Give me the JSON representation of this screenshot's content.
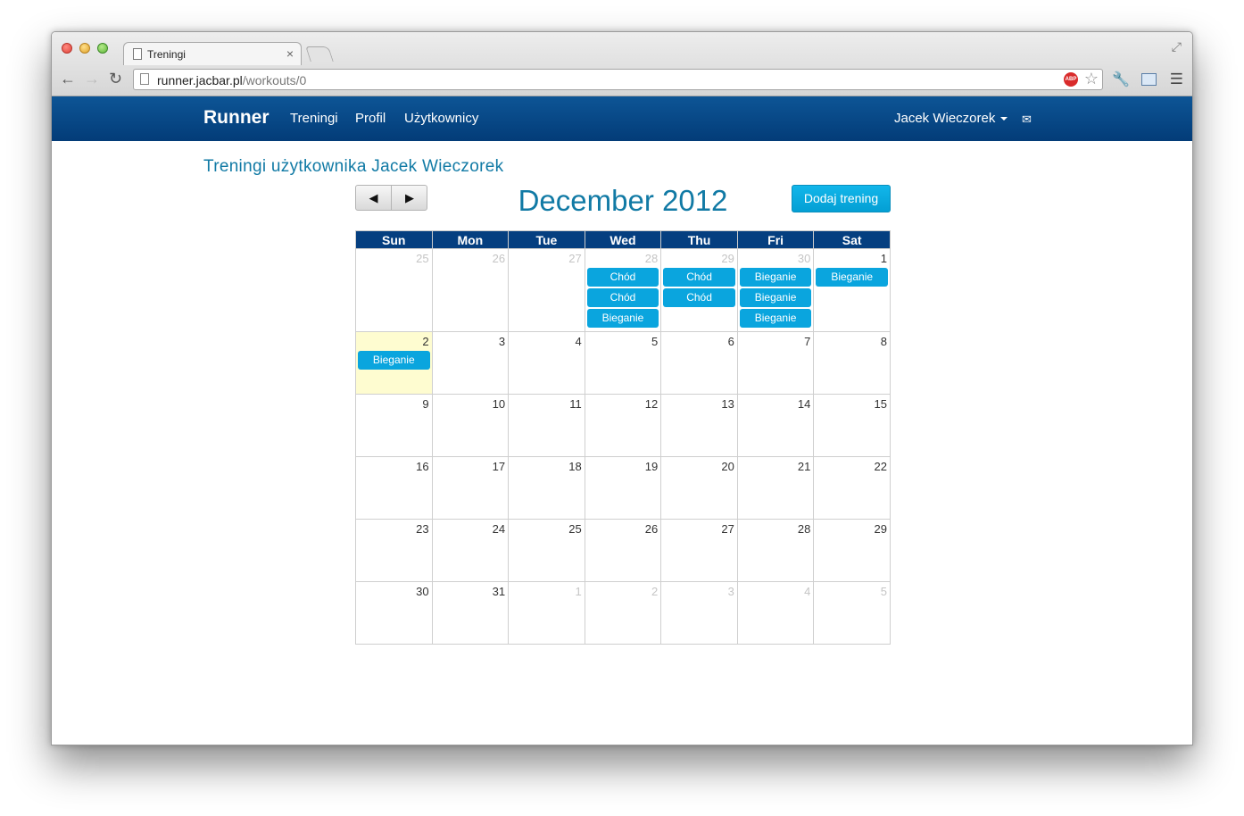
{
  "browser": {
    "tab_title": "Treningi",
    "tab_close": "×",
    "url_host": "runner.jacbar.pl",
    "url_path": "/workouts/0",
    "abp_label": "ABP"
  },
  "navbar": {
    "brand": "Runner",
    "links": [
      "Treningi",
      "Profil",
      "Użytkownicy"
    ],
    "user": "Jacek Wieczorek"
  },
  "page": {
    "heading": "Treningi użytkownika Jacek Wieczorek",
    "calendar_title": "December 2012",
    "add_button": "Dodaj trening",
    "prev": "◀",
    "next": "▶"
  },
  "calendar": {
    "weekdays": [
      "Sun",
      "Mon",
      "Tue",
      "Wed",
      "Thu",
      "Fri",
      "Sat"
    ],
    "weeks": [
      [
        {
          "day": "25",
          "other": true,
          "events": []
        },
        {
          "day": "26",
          "other": true,
          "events": []
        },
        {
          "day": "27",
          "other": true,
          "events": []
        },
        {
          "day": "28",
          "other": true,
          "events": [
            "Chód",
            "Chód",
            "Bieganie"
          ]
        },
        {
          "day": "29",
          "other": true,
          "events": [
            "Chód",
            "Chód"
          ]
        },
        {
          "day": "30",
          "other": true,
          "events": [
            "Bieganie",
            "Bieganie",
            "Bieganie"
          ]
        },
        {
          "day": "1",
          "other": false,
          "events": [
            "Bieganie"
          ]
        }
      ],
      [
        {
          "day": "2",
          "other": false,
          "today": true,
          "events": [
            "Bieganie"
          ]
        },
        {
          "day": "3",
          "other": false,
          "events": []
        },
        {
          "day": "4",
          "other": false,
          "events": []
        },
        {
          "day": "5",
          "other": false,
          "events": []
        },
        {
          "day": "6",
          "other": false,
          "events": []
        },
        {
          "day": "7",
          "other": false,
          "events": []
        },
        {
          "day": "8",
          "other": false,
          "events": []
        }
      ],
      [
        {
          "day": "9",
          "other": false,
          "events": []
        },
        {
          "day": "10",
          "other": false,
          "events": []
        },
        {
          "day": "11",
          "other": false,
          "events": []
        },
        {
          "day": "12",
          "other": false,
          "events": []
        },
        {
          "day": "13",
          "other": false,
          "events": []
        },
        {
          "day": "14",
          "other": false,
          "events": []
        },
        {
          "day": "15",
          "other": false,
          "events": []
        }
      ],
      [
        {
          "day": "16",
          "other": false,
          "events": []
        },
        {
          "day": "17",
          "other": false,
          "events": []
        },
        {
          "day": "18",
          "other": false,
          "events": []
        },
        {
          "day": "19",
          "other": false,
          "events": []
        },
        {
          "day": "20",
          "other": false,
          "events": []
        },
        {
          "day": "21",
          "other": false,
          "events": []
        },
        {
          "day": "22",
          "other": false,
          "events": []
        }
      ],
      [
        {
          "day": "23",
          "other": false,
          "events": []
        },
        {
          "day": "24",
          "other": false,
          "events": []
        },
        {
          "day": "25",
          "other": false,
          "events": []
        },
        {
          "day": "26",
          "other": false,
          "events": []
        },
        {
          "day": "27",
          "other": false,
          "events": []
        },
        {
          "day": "28",
          "other": false,
          "events": []
        },
        {
          "day": "29",
          "other": false,
          "events": []
        }
      ],
      [
        {
          "day": "30",
          "other": false,
          "events": []
        },
        {
          "day": "31",
          "other": false,
          "events": []
        },
        {
          "day": "1",
          "other": true,
          "events": []
        },
        {
          "day": "2",
          "other": true,
          "events": []
        },
        {
          "day": "3",
          "other": true,
          "events": []
        },
        {
          "day": "4",
          "other": true,
          "events": []
        },
        {
          "day": "5",
          "other": true,
          "events": []
        }
      ]
    ]
  },
  "colors": {
    "navbar": "#053f80",
    "accent": "#117aa5",
    "event": "#0aa5de",
    "today": "#fefcd0"
  }
}
